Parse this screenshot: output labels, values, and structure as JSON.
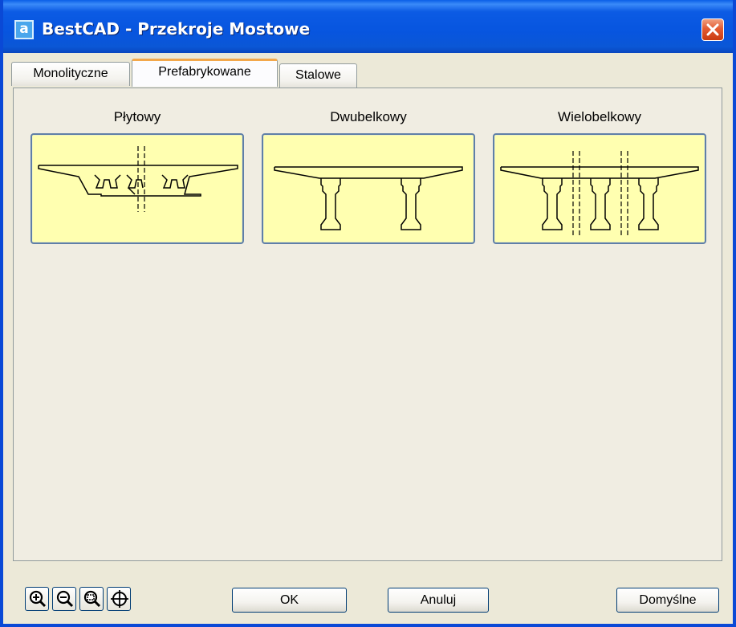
{
  "window": {
    "title": "BestCAD - Przekroje Mostowe",
    "app_icon_letter": "a",
    "titlebar_color": "#0a5be4",
    "close_icon": "close-icon"
  },
  "tabs": [
    {
      "label": "Monolityczne",
      "active": false
    },
    {
      "label": "Prefabrykowane",
      "active": true
    },
    {
      "label": "Stalowe",
      "active": false
    }
  ],
  "sections": [
    {
      "label": "Płytowy",
      "preview_icon": "slab-bridge-section-icon"
    },
    {
      "label": "Dwubelkowy",
      "preview_icon": "two-beam-bridge-section-icon"
    },
    {
      "label": "Wielobelkowy",
      "preview_icon": "multi-beam-bridge-section-icon"
    }
  ],
  "preview_background": "#ffffb0",
  "zoom_tools": [
    {
      "icon": "zoom-in-icon"
    },
    {
      "icon": "zoom-out-icon"
    },
    {
      "icon": "zoom-window-icon"
    },
    {
      "icon": "zoom-pan-icon"
    }
  ],
  "buttons": {
    "ok": "OK",
    "cancel": "Anuluj",
    "default": "Domyślne"
  }
}
